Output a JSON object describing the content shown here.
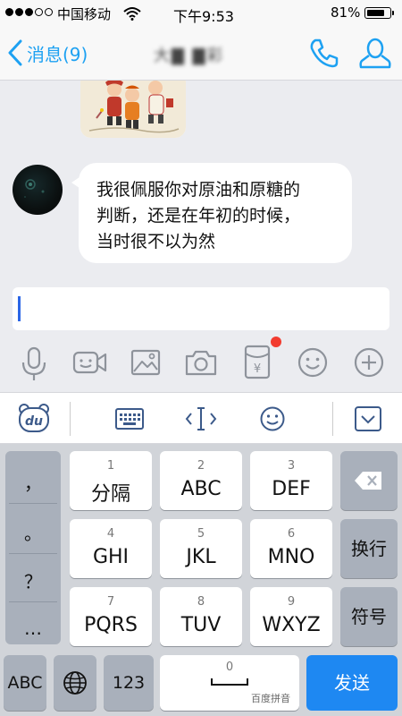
{
  "status_bar": {
    "carrier": "中国移动",
    "time": "下午9:53",
    "battery_percent": "81%",
    "battery_level": 0.81,
    "signal_bars_filled": 3,
    "signal_bars_total": 5
  },
  "nav": {
    "back_label": "消息(9)",
    "contact_name": "大▇ ▇彩",
    "accent_color": "#1da1f2"
  },
  "chat": {
    "messages": [
      {
        "type": "sticker",
        "description_icon": "new-year-children-sticker"
      },
      {
        "type": "text",
        "text_lines": [
          "我很佩服你对原油和原糖的",
          "判断，还是在年初的时候，",
          "当时很不以为然"
        ]
      }
    ]
  },
  "input": {
    "value": ""
  },
  "toolbar": {
    "icons": [
      "microphone-icon",
      "video-call-icon",
      "image-icon",
      "camera-icon",
      "red-packet-icon",
      "emoji-icon",
      "plus-icon"
    ],
    "red_packet_symbol": "¥",
    "notification_color": "#f23b2f"
  },
  "keyboard_top": {
    "logo": "du",
    "icons": [
      "keyboard-icon",
      "cursor-icon",
      "emoji-icon",
      "collapse-keyboard-icon"
    ]
  },
  "keyboard": {
    "punctuation": [
      "，",
      "。",
      "？",
      "…"
    ],
    "keys": [
      {
        "num": "1",
        "label": "分隔"
      },
      {
        "num": "2",
        "label": "ABC"
      },
      {
        "num": "3",
        "label": "DEF"
      },
      {
        "num": "4",
        "label": "GHI"
      },
      {
        "num": "5",
        "label": "JKL"
      },
      {
        "num": "6",
        "label": "MNO"
      },
      {
        "num": "7",
        "label": "PQRS"
      },
      {
        "num": "8",
        "label": "TUV"
      },
      {
        "num": "9",
        "label": "WXYZ"
      }
    ],
    "newline": "换行",
    "symbols": "符号",
    "abc": "ABC",
    "num_switch": "123",
    "space_num": "0",
    "space_hint": "百度拼音",
    "send": "发送",
    "send_color": "#1e88f2"
  }
}
